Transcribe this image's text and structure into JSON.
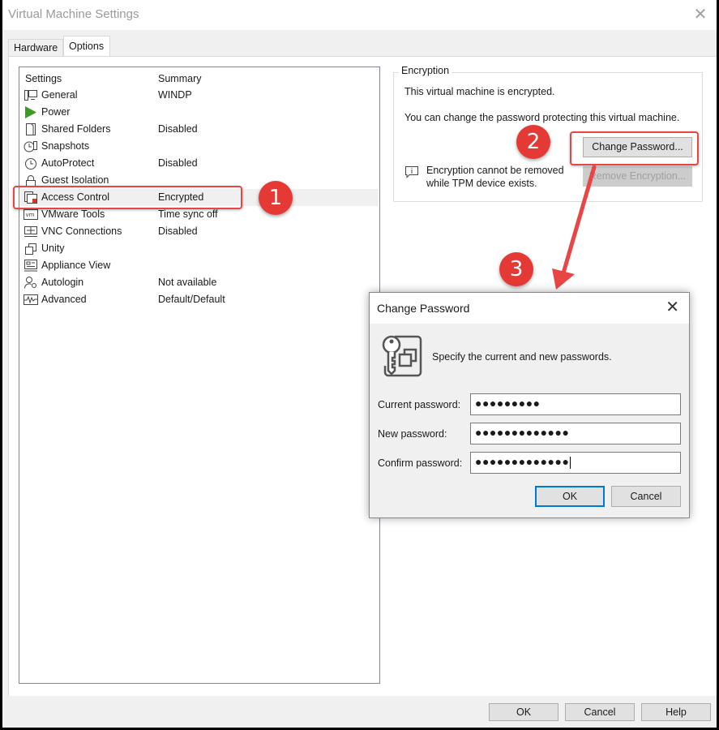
{
  "window": {
    "title": "Virtual Machine Settings",
    "close_glyph": "✕"
  },
  "tabs": [
    {
      "label": "Hardware",
      "active": false
    },
    {
      "label": "Options",
      "active": true
    }
  ],
  "settings_list": {
    "header": {
      "settings": "Settings",
      "summary": "Summary"
    },
    "items": [
      {
        "name": "General",
        "summary": "WINDP",
        "icon": "monitor-icon"
      },
      {
        "name": "Power",
        "summary": "",
        "icon": "play-icon"
      },
      {
        "name": "Shared Folders",
        "summary": "Disabled",
        "icon": "folder-icon"
      },
      {
        "name": "Snapshots",
        "summary": "",
        "icon": "snapshot-clock-icon"
      },
      {
        "name": "AutoProtect",
        "summary": "Disabled",
        "icon": "clock-icon"
      },
      {
        "name": "Guest Isolation",
        "summary": "",
        "icon": "lock-icon"
      },
      {
        "name": "Access Control",
        "summary": "Encrypted",
        "icon": "access-control-icon",
        "selected": true
      },
      {
        "name": "VMware Tools",
        "summary": "Time sync off",
        "icon": "vm-icon"
      },
      {
        "name": "VNC Connections",
        "summary": "Disabled",
        "icon": "network-icon"
      },
      {
        "name": "Unity",
        "summary": "",
        "icon": "windows-icon"
      },
      {
        "name": "Appliance View",
        "summary": "",
        "icon": "appliance-icon"
      },
      {
        "name": "Autologin",
        "summary": "Not available",
        "icon": "user-key-icon"
      },
      {
        "name": "Advanced",
        "summary": "Default/Default",
        "icon": "waveform-icon"
      }
    ]
  },
  "encryption": {
    "legend": "Encryption",
    "status_text": "This virtual machine is encrypted.",
    "change_text": "You can change the password protecting this virtual machine.",
    "change_password_label": "Change Password...",
    "remove_encryption_label": "Remove Encryption...",
    "info_text_line1": "Encryption cannot be removed",
    "info_text_line2": "while TPM device exists."
  },
  "footer_buttons": {
    "ok": "OK",
    "cancel": "Cancel",
    "help": "Help"
  },
  "change_password_dialog": {
    "title": "Change Password",
    "close_glyph": "✕",
    "description": "Specify the current and new passwords.",
    "fields": [
      {
        "label": "Current password:",
        "value": "●●●●●●●●●"
      },
      {
        "label": "New password:",
        "value": "●●●●●●●●●●●●●"
      },
      {
        "label": "Confirm password:",
        "value": "●●●●●●●●●●●●●"
      }
    ],
    "ok_label": "OK",
    "cancel_label": "Cancel"
  },
  "annotations": {
    "step1": "1",
    "step2": "2",
    "step3": "3",
    "color": "#e53935"
  }
}
